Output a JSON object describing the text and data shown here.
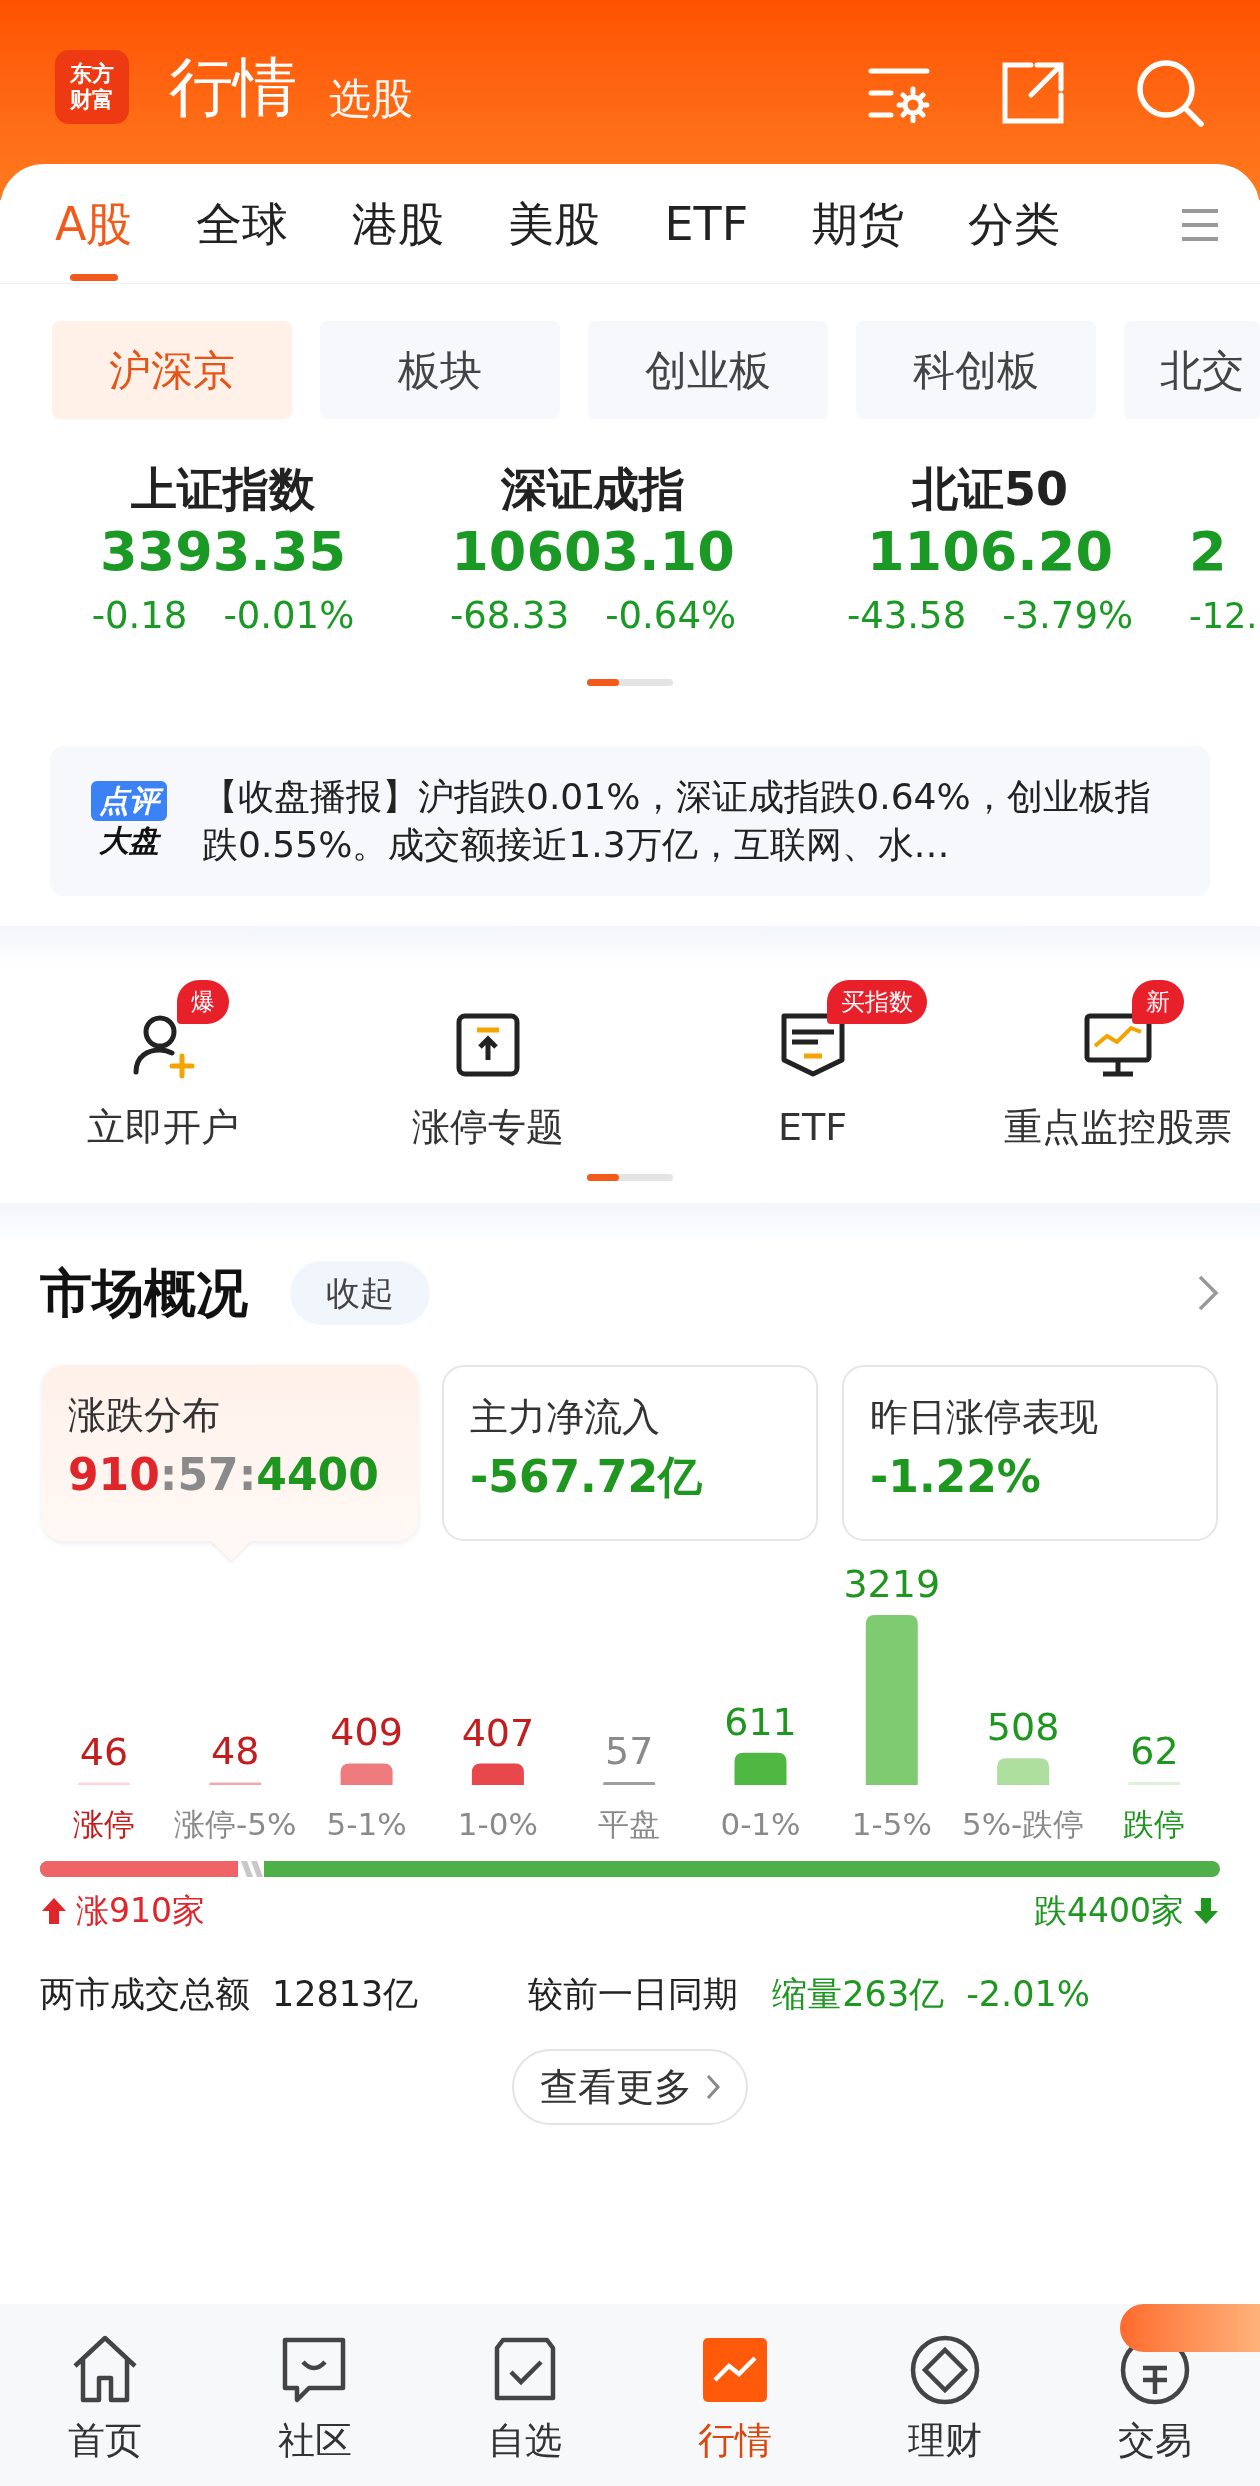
{
  "header": {
    "logo_lines": [
      "东方",
      "财富"
    ],
    "title": "行情",
    "subtitle": "选股"
  },
  "tabs": [
    {
      "label": "A股",
      "selected": true
    },
    {
      "label": "全球",
      "selected": false
    },
    {
      "label": "港股",
      "selected": false
    },
    {
      "label": "美股",
      "selected": false
    },
    {
      "label": "ETF",
      "selected": false
    },
    {
      "label": "期货",
      "selected": false
    },
    {
      "label": "分类",
      "selected": false
    }
  ],
  "sub_tabs": [
    {
      "label": "沪深京",
      "selected": true
    },
    {
      "label": "板块",
      "selected": false
    },
    {
      "label": "创业板",
      "selected": false
    },
    {
      "label": "科创板",
      "selected": false
    },
    {
      "label": "北交",
      "selected": false
    }
  ],
  "indices": [
    {
      "name": "上证指数",
      "value": "3393.35",
      "change": "-0.18",
      "percent": "-0.01%"
    },
    {
      "name": "深证成指",
      "value": "10603.10",
      "change": "-68.33",
      "percent": "-0.64%"
    },
    {
      "name": "北证50",
      "value": "1106.20",
      "change": "-43.58",
      "percent": "-3.79%"
    },
    {
      "value": "2",
      "change": "-12."
    }
  ],
  "news": {
    "badge_top": "点评",
    "badge_bottom": "大盘",
    "text": "【收盘播报】沪指跌0.01%，深证成指跌0.64%，创业板指跌0.55%。成交额接近1.3万亿，互联网、水…"
  },
  "shortcuts": [
    {
      "kind": "person",
      "label": "立即开户",
      "badge": "爆"
    },
    {
      "kind": "limit",
      "label": "涨停专题"
    },
    {
      "kind": "etf",
      "label": "ETF",
      "badge": "买指数"
    },
    {
      "kind": "monitor",
      "label": "重点监控股票",
      "badge": "新"
    }
  ],
  "market": {
    "title": "市场概况",
    "collapse": "收起",
    "cards": [
      {
        "label": "涨跌分布",
        "selected": true,
        "parts": [
          {
            "text": "910",
            "color": "#e0262b"
          },
          {
            "text": ":57:",
            "color": "#8a8a8a"
          },
          {
            "text": "4400",
            "color": "#1f961f"
          }
        ]
      },
      {
        "label": "主力净流入",
        "selected": false,
        "parts": [
          {
            "text": "-567.72亿",
            "color": "#1f961f"
          }
        ]
      },
      {
        "label": "昨日涨停表现",
        "selected": false,
        "parts": [
          {
            "text": "-1.22%",
            "color": "#1f961f"
          }
        ]
      }
    ],
    "chart_data": {
      "type": "bar",
      "categories": [
        "涨停",
        "涨停-5%",
        "5-1%",
        "1-0%",
        "平盘",
        "0-1%",
        "1-5%",
        "5%-跌停",
        "跌停"
      ],
      "values": [
        46,
        48,
        409,
        407,
        57,
        611,
        3219,
        508,
        62
      ],
      "colors": [
        "#fdd5d5",
        "#f6a9ab",
        "#ee7b7e",
        "#e8474b",
        "#9e9e9e",
        "#4fb842",
        "#7fcb72",
        "#aedf9f",
        "#dff1d9"
      ],
      "data_labels": true
    },
    "breadth": {
      "level": 0.168,
      "up": "涨910家",
      "down": "跌4400家"
    },
    "turnover": {
      "label": "两市成交总额",
      "value": "12813亿",
      "compare_label": "较前一日同期",
      "change": "缩量263亿",
      "percent": "-2.01%"
    },
    "more": "查看更多"
  },
  "nav": [
    {
      "kind": "home",
      "label": "首页",
      "selected": false
    },
    {
      "kind": "chat",
      "label": "社区",
      "selected": false
    },
    {
      "kind": "check",
      "label": "自选",
      "selected": false
    },
    {
      "kind": "chart",
      "label": "行情",
      "selected": true
    },
    {
      "kind": "diamond",
      "label": "理财",
      "selected": false
    },
    {
      "kind": "yen",
      "label": "交易",
      "selected": false
    }
  ]
}
